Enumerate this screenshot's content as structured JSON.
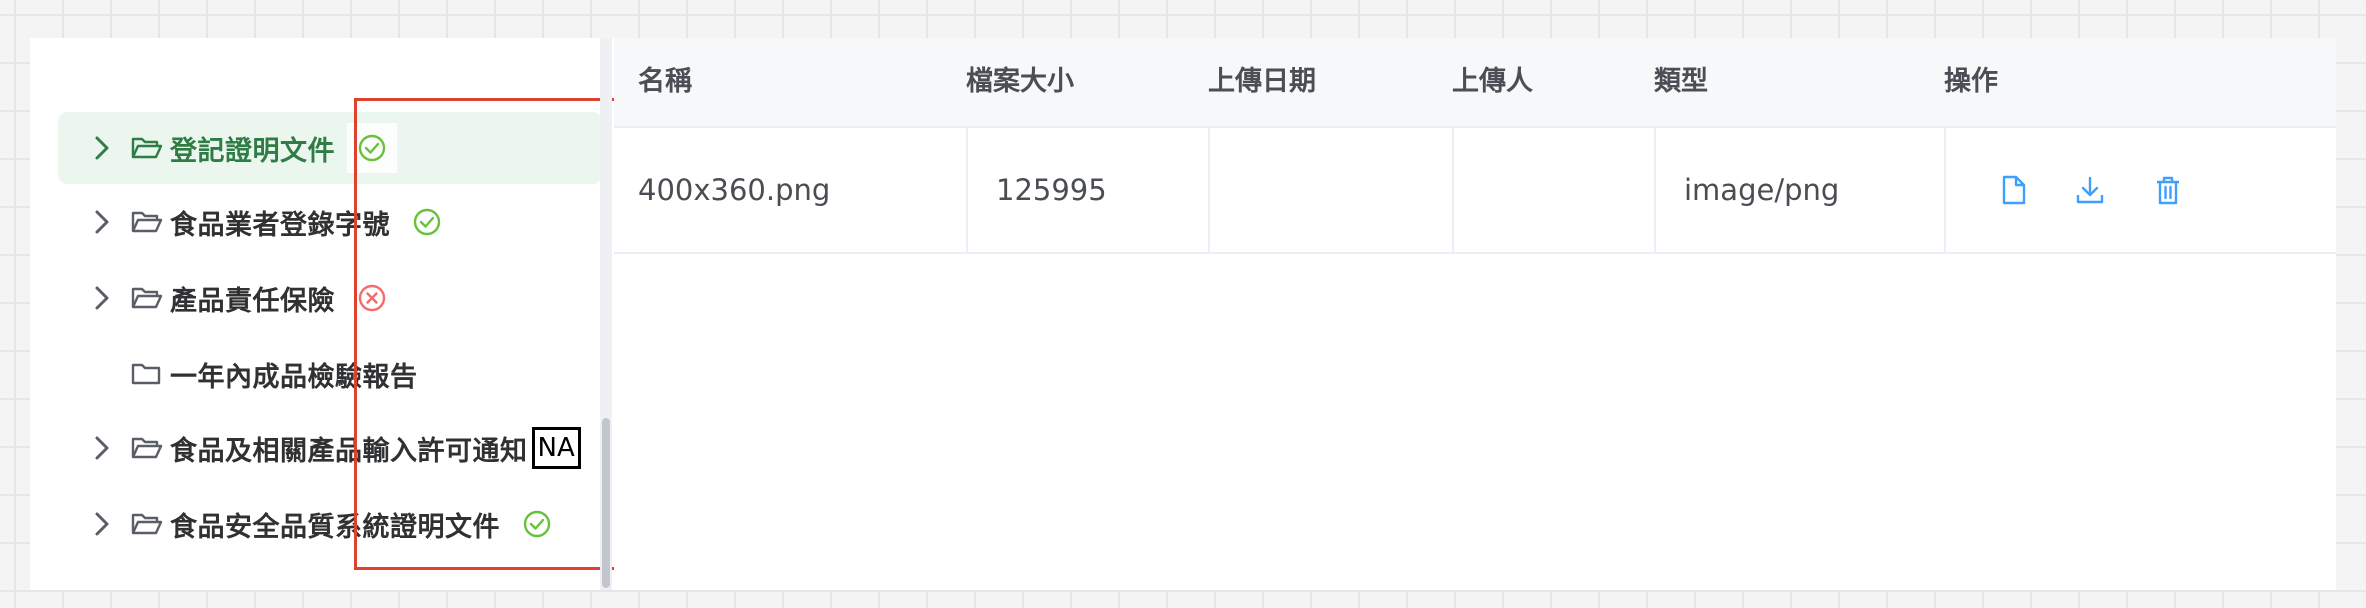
{
  "tree": {
    "items": [
      {
        "label": "登記證明文件",
        "expandable": true,
        "selected": true,
        "status": "check"
      },
      {
        "label": "食品業者登錄字號",
        "expandable": true,
        "selected": false,
        "status": "check"
      },
      {
        "label": "產品責任保險",
        "expandable": true,
        "selected": false,
        "status": "error"
      },
      {
        "label": "一年內成品檢驗報告",
        "expandable": false,
        "selected": false,
        "status": "none"
      },
      {
        "label": "食品及相關產品輸入許可通知",
        "expandable": true,
        "selected": false,
        "status": "na",
        "status_text": "NA"
      },
      {
        "label": "食品安全品質系統證明文件",
        "expandable": true,
        "selected": false,
        "status": "check"
      }
    ]
  },
  "table": {
    "headers": {
      "name": "名稱",
      "size": "檔案大小",
      "date": "上傳日期",
      "uploader": "上傳人",
      "type": "類型",
      "actions": "操作"
    },
    "rows": [
      {
        "name": "400x360.png",
        "size": "125995",
        "date": "",
        "uploader": "",
        "type": "image/png"
      }
    ]
  },
  "icons": {
    "expand": "chevron-right-icon",
    "folder_open": "folder-open-icon",
    "folder": "folder-icon",
    "check": "check-circle-icon",
    "error": "close-circle-icon",
    "view": "document-icon",
    "download": "download-icon",
    "delete": "trash-icon"
  },
  "colors": {
    "accent_green": "#2f7d45",
    "selected_bg": "#eaf6ee",
    "success": "#67c23a",
    "danger": "#f56c6c",
    "action_blue": "#409eff",
    "highlight_border": "#e0412e"
  }
}
